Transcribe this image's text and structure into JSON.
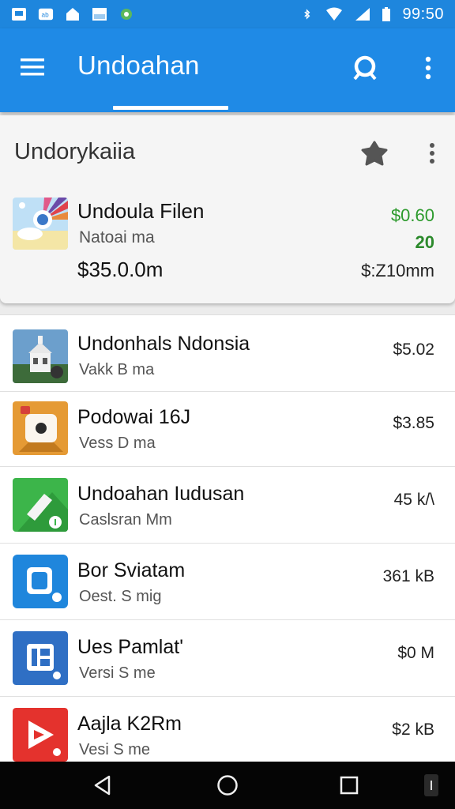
{
  "status_bar": {
    "time": "99:50",
    "icons": [
      "sd-card-icon",
      "cast-icon",
      "home-icon",
      "image-icon",
      "android-icon",
      "bluetooth-icon",
      "wifi-icon",
      "signal-icon",
      "battery-icon"
    ]
  },
  "app_bar": {
    "title": "Undoahan",
    "icons": [
      "menu-icon",
      "search-icon",
      "more-vert-icon"
    ],
    "color": "#1f8ae6"
  },
  "featured": {
    "section_title": "Undorykaiia",
    "item": {
      "name": "Undoula Filen",
      "subtitle": "Natoai ma",
      "price": "$35.0.0m",
      "right_top": "$0.60",
      "right_mid": "20",
      "right_bottom": "$:Z10mm"
    },
    "icons": [
      "pin-icon",
      "more-vert-icon"
    ],
    "accent": "#2c9a2c"
  },
  "list": [
    {
      "name": "Undonhals Ndonsia",
      "subtitle": "Vakk B ma",
      "value": "$5.02",
      "icon": "house-icon"
    },
    {
      "name": "Podowai 16J",
      "subtitle": "Vess D ma",
      "value": "$3.85",
      "icon": "camera-icon"
    },
    {
      "name": "Undoahan Iudusan",
      "subtitle": "Caslsran Mm",
      "value": "45 k/\\",
      "icon": "pencil-icon"
    },
    {
      "name": "Bor Sviatam",
      "subtitle": "Oest. S mig",
      "value": "361 kB",
      "icon": "bag-icon"
    },
    {
      "name": "Ues Pamlat'",
      "subtitle": "Versi S me",
      "value": "$0 M",
      "icon": "doc-icon"
    },
    {
      "name": "Aajla K2Rm",
      "subtitle": "Vesi S me",
      "value": "$2 kB",
      "icon": "play-icon"
    }
  ],
  "nav_bar": {
    "icons": [
      "back-icon",
      "home-circle-icon",
      "recents-icon",
      "more-icon"
    ]
  }
}
